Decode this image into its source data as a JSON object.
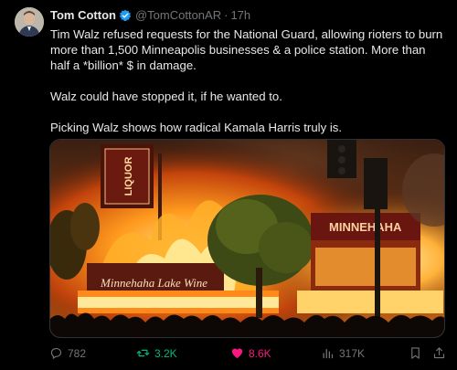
{
  "author": {
    "name": "Tom Cotton",
    "handle": "@TomCottonAR",
    "separator": "·",
    "time": "17h",
    "verified_color": "#1d9bf0"
  },
  "post": {
    "paragraph1": "Tim Walz refused requests for the National Guard, allowing rioters to burn more than 1,500 Minneapolis businesses & a police station. More than half a *billion* $ in damage.",
    "paragraph2": "Walz could have stopped it, if he wanted to.",
    "paragraph3": "Picking Walz shows how radical Kamala Harris truly is."
  },
  "media": {
    "sign_liquor": "LIQUOR",
    "sign_minnehaha": "MINNEHAHA",
    "sign_lake": "Minnehaha Lake Wine"
  },
  "actions": {
    "replies": "782",
    "reposts": "3.2K",
    "likes": "8.6K",
    "views": "317K",
    "repost_color": "#00ba7c",
    "like_color": "#f91880"
  }
}
